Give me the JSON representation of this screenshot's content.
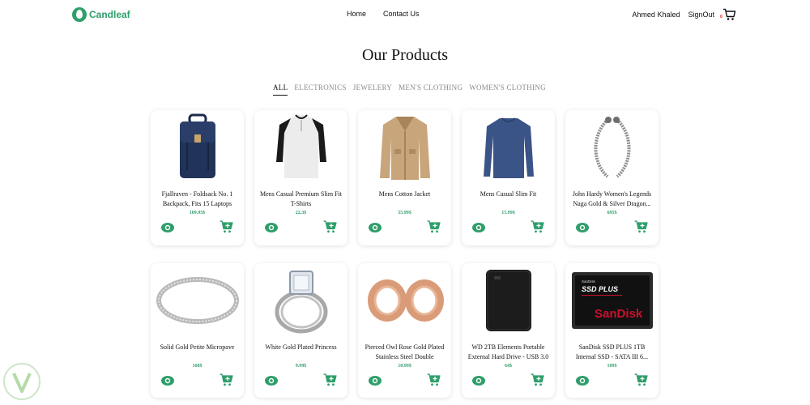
{
  "brand": {
    "name": "Candleaf"
  },
  "nav": {
    "home": "Home",
    "contact": "Contact Us"
  },
  "user": {
    "name": "Ahmed Khaled",
    "signout": "SignOut",
    "cart_count": "0"
  },
  "page": {
    "title": "Our Products"
  },
  "filters": [
    "ALL",
    "ELECTRONICS",
    "JEWELERY",
    "MEN'S CLOTHING",
    "WOMEN'S CLOTHING"
  ],
  "products": [
    {
      "title": "Fjallraven - Foldsack No. 1 Backpack, Fits 15 Laptops",
      "price": "109.95$",
      "icon": "backpack-image"
    },
    {
      "title": "Mens Casual Premium Slim Fit T-Shirts",
      "price": "22.3$",
      "icon": "tshirt-image"
    },
    {
      "title": "Mens Cotton Jacket",
      "price": "55.99$",
      "icon": "jacket-image"
    },
    {
      "title": "Mens Casual Slim Fit",
      "price": "15.99$",
      "icon": "sweater-image"
    },
    {
      "title": "John Hardy Women's Legends Naga Gold & Silver Dragon...",
      "price": "695$",
      "icon": "bracelet-image"
    },
    {
      "title": "Solid Gold Petite Micropave",
      "price": "168$",
      "icon": "ring-image"
    },
    {
      "title": "White Gold Plated Princess",
      "price": "9.99$",
      "icon": "princess-ring-image"
    },
    {
      "title": "Pierced Owl Rose Gold Plated Stainless Steel Double",
      "price": "10.99$",
      "icon": "earring-tunnels-image"
    },
    {
      "title": "WD 2TB Elements Portable External Hard Drive - USB 3.0",
      "price": "64$",
      "icon": "hard-drive-image"
    },
    {
      "title": "SanDisk SSD PLUS 1TB Internal SSD - SATA III 6...",
      "price": "109$",
      "icon": "ssd-image"
    }
  ],
  "ssd_label": {
    "line1": "SanDisk",
    "line2": "SSD PLUS",
    "brand": "SanDisk"
  },
  "colors": {
    "accent": "#2f9e6b",
    "badge": "#e01b1b"
  }
}
